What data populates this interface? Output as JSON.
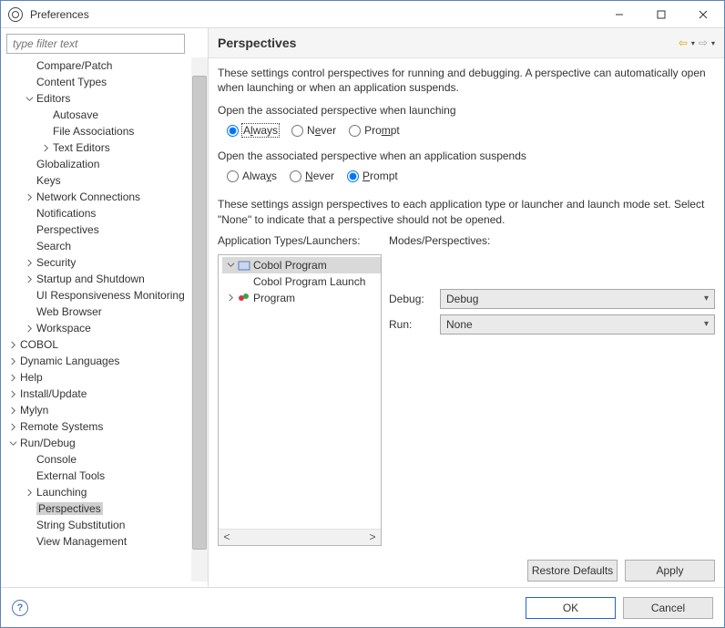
{
  "window": {
    "title": "Preferences"
  },
  "sidebar": {
    "filter_placeholder": "type filter text",
    "items": {
      "compare": "Compare/Patch",
      "contenttypes": "Content Types",
      "editors": "Editors",
      "autosave": "Autosave",
      "fileassoc": "File Associations",
      "texteditors": "Text Editors",
      "globalization": "Globalization",
      "keys": "Keys",
      "network": "Network Connections",
      "notifications": "Notifications",
      "perspectives": "Perspectives",
      "search": "Search",
      "security": "Security",
      "startup": "Startup and Shutdown",
      "uiresp": "UI Responsiveness Monitoring",
      "web": "Web Browser",
      "workspace": "Workspace",
      "cobol": "COBOL",
      "dyn": "Dynamic Languages",
      "help": "Help",
      "install": "Install/Update",
      "mylyn": "Mylyn",
      "remote": "Remote Systems",
      "rundebug": "Run/Debug",
      "console": "Console",
      "externaltools": "External Tools",
      "launching": "Launching",
      "rd_perspectives": "Perspectives",
      "stringsub": "String Substitution",
      "viewmgmt": "View Management"
    }
  },
  "main": {
    "heading": "Perspectives",
    "intro": "These settings control perspectives for running and debugging. A perspective can automatically open when launching or when an application suspends.",
    "group1_title": "Open the associated perspective when launching",
    "group2_title": "Open the associated perspective when an application suspends",
    "radios": {
      "always_html": "A<span class=\"ul-letter\">l</span>ways",
      "never_html": "N<span class=\"ul-letter\">e</span>ver",
      "prompt_html": "Pro<span class=\"ul-letter\">m</span>pt",
      "always2_html": "Alwa<span class=\"ul-letter\">y</span>s",
      "never2_html": "<span class=\"ul-letter\">N</span>ever",
      "prompt2_html": "<span class=\"ul-letter\">P</span>rompt"
    },
    "assign_intro": "These settings assign perspectives to each application type or launcher and launch mode set. Select \"None\" to indicate that a perspective should not be opened.",
    "apps_label": "Application Types/Launchers:",
    "modes_label": "Modes/Perspectives:",
    "apptree": {
      "cobol": "Cobol Program",
      "cobol_launch": "Cobol Program Launch",
      "program": "Program"
    },
    "modes": {
      "debug_label": "Debug:",
      "debug_value": "Debug",
      "run_label": "Run:",
      "run_value": "None"
    },
    "buttons": {
      "restore": "Restore Defaults",
      "apply": "Apply",
      "ok": "OK",
      "cancel": "Cancel"
    }
  }
}
